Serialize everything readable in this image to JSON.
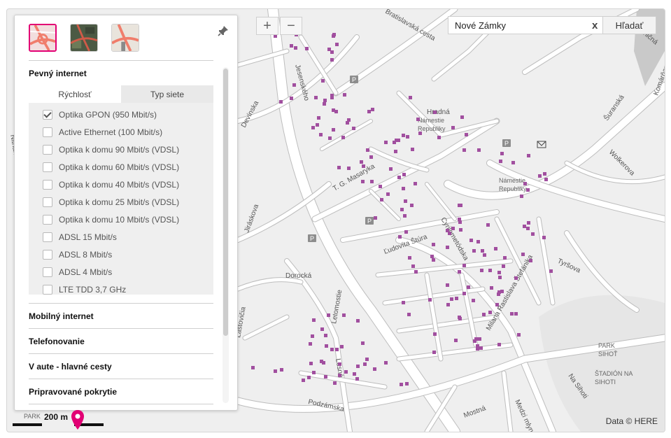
{
  "search": {
    "value": "Nové Zámky",
    "clear_label": "x",
    "button_label": "Hľadať"
  },
  "zoom": {
    "in_label": "+",
    "out_label": "−"
  },
  "panel": {
    "section_fixed": "Pevný internet",
    "tabs": [
      "Rýchlosť",
      "Typ siete"
    ],
    "options": [
      {
        "label": "Optika GPON (950 Mbit/s)",
        "checked": true
      },
      {
        "label": "Active Ethernet (100 Mbit/s)",
        "checked": false
      },
      {
        "label": "Optika k domu 90 Mbit/s (VDSL)",
        "checked": false
      },
      {
        "label": "Optika k domu 60 Mbit/s (VDSL)",
        "checked": false
      },
      {
        "label": "Optika k domu 40 Mbit/s (VDSL)",
        "checked": false
      },
      {
        "label": "Optika k domu 25 Mbit/s (VDSL)",
        "checked": false
      },
      {
        "label": "Optika k domu 10 Mbit/s (VDSL)",
        "checked": false
      },
      {
        "label": "ADSL 15 Mbit/s",
        "checked": false
      },
      {
        "label": "ADSL 8 Mbit/s",
        "checked": false
      },
      {
        "label": "ADSL 4 Mbit/s",
        "checked": false
      },
      {
        "label": "LTE TDD 3,7 GHz",
        "checked": false
      }
    ],
    "other_sections": [
      "Mobilný internet",
      "Telefonovanie",
      "V aute - hlavné cesty",
      "Pripravované pokrytie"
    ]
  },
  "map": {
    "scale_label": "200 m",
    "attribution": "Data © HERE",
    "street_labels": [
      "Devínska",
      "Nitrianska",
      "T. G. Masaryka",
      "Jiráskova",
      "Dorocká",
      "Lastovičia",
      "Ľudovíta Štúra",
      "Cyrilometódska",
      "Milana Rastislava Štefánika",
      "Šuranská",
      "Wolkerova",
      "Tyršova",
      "Podzámska",
      "Mostná",
      "Medzi mlynmi",
      "Na Sihoti",
      "Bratislavská cesta",
      "Komárňanská",
      "Železničná",
      "Letomostie",
      "Lesná",
      "Jesenského",
      "Hradná"
    ],
    "area_labels": [
      "Námestie Republiky",
      "Námestie Republiky",
      "PARK SIHOŤ",
      "ŠTADIÓN NA SIHOTI",
      "PARK"
    ],
    "accent_color": "#e20074",
    "coverage_color": "#a14f9f"
  }
}
